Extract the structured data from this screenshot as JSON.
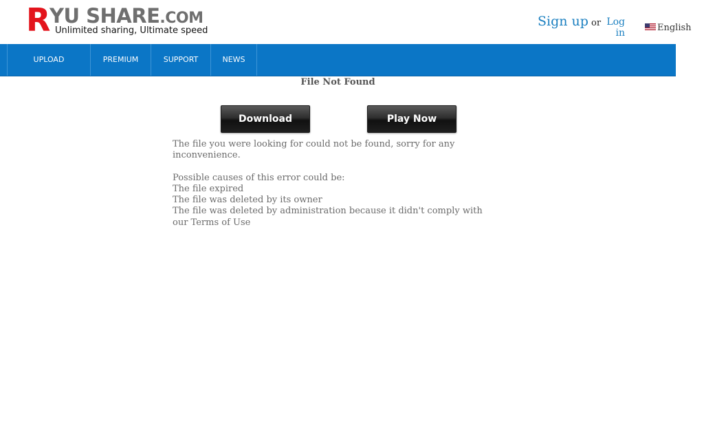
{
  "header": {
    "logo": {
      "letter": "R",
      "word": "YU SHARE",
      "suffix": ".COM",
      "tagline": "Unlimited sharing, Ultimate speed"
    },
    "auth": {
      "signup": "Sign up",
      "or": "or",
      "login": "Log in"
    },
    "language": {
      "label": "English",
      "icon": "us-flag-icon"
    }
  },
  "nav": {
    "items": [
      {
        "label": "UPLOAD"
      },
      {
        "label": "PREMIUM"
      },
      {
        "label": "SUPPORT"
      },
      {
        "label": "NEWS"
      }
    ],
    "color": "#0b76c6"
  },
  "main": {
    "title": "File Not Found",
    "buttons": {
      "download": "Download",
      "play": "Play Now"
    },
    "message": {
      "line1": "The file you were looking for could not be found, sorry for any inconvenience.",
      "causes_heading": "Possible causes of this error could be:",
      "cause1": "The file expired",
      "cause2": "The file was deleted by its owner",
      "cause3": "The file was deleted by administration because it didn't comply with our Terms of Use"
    }
  }
}
